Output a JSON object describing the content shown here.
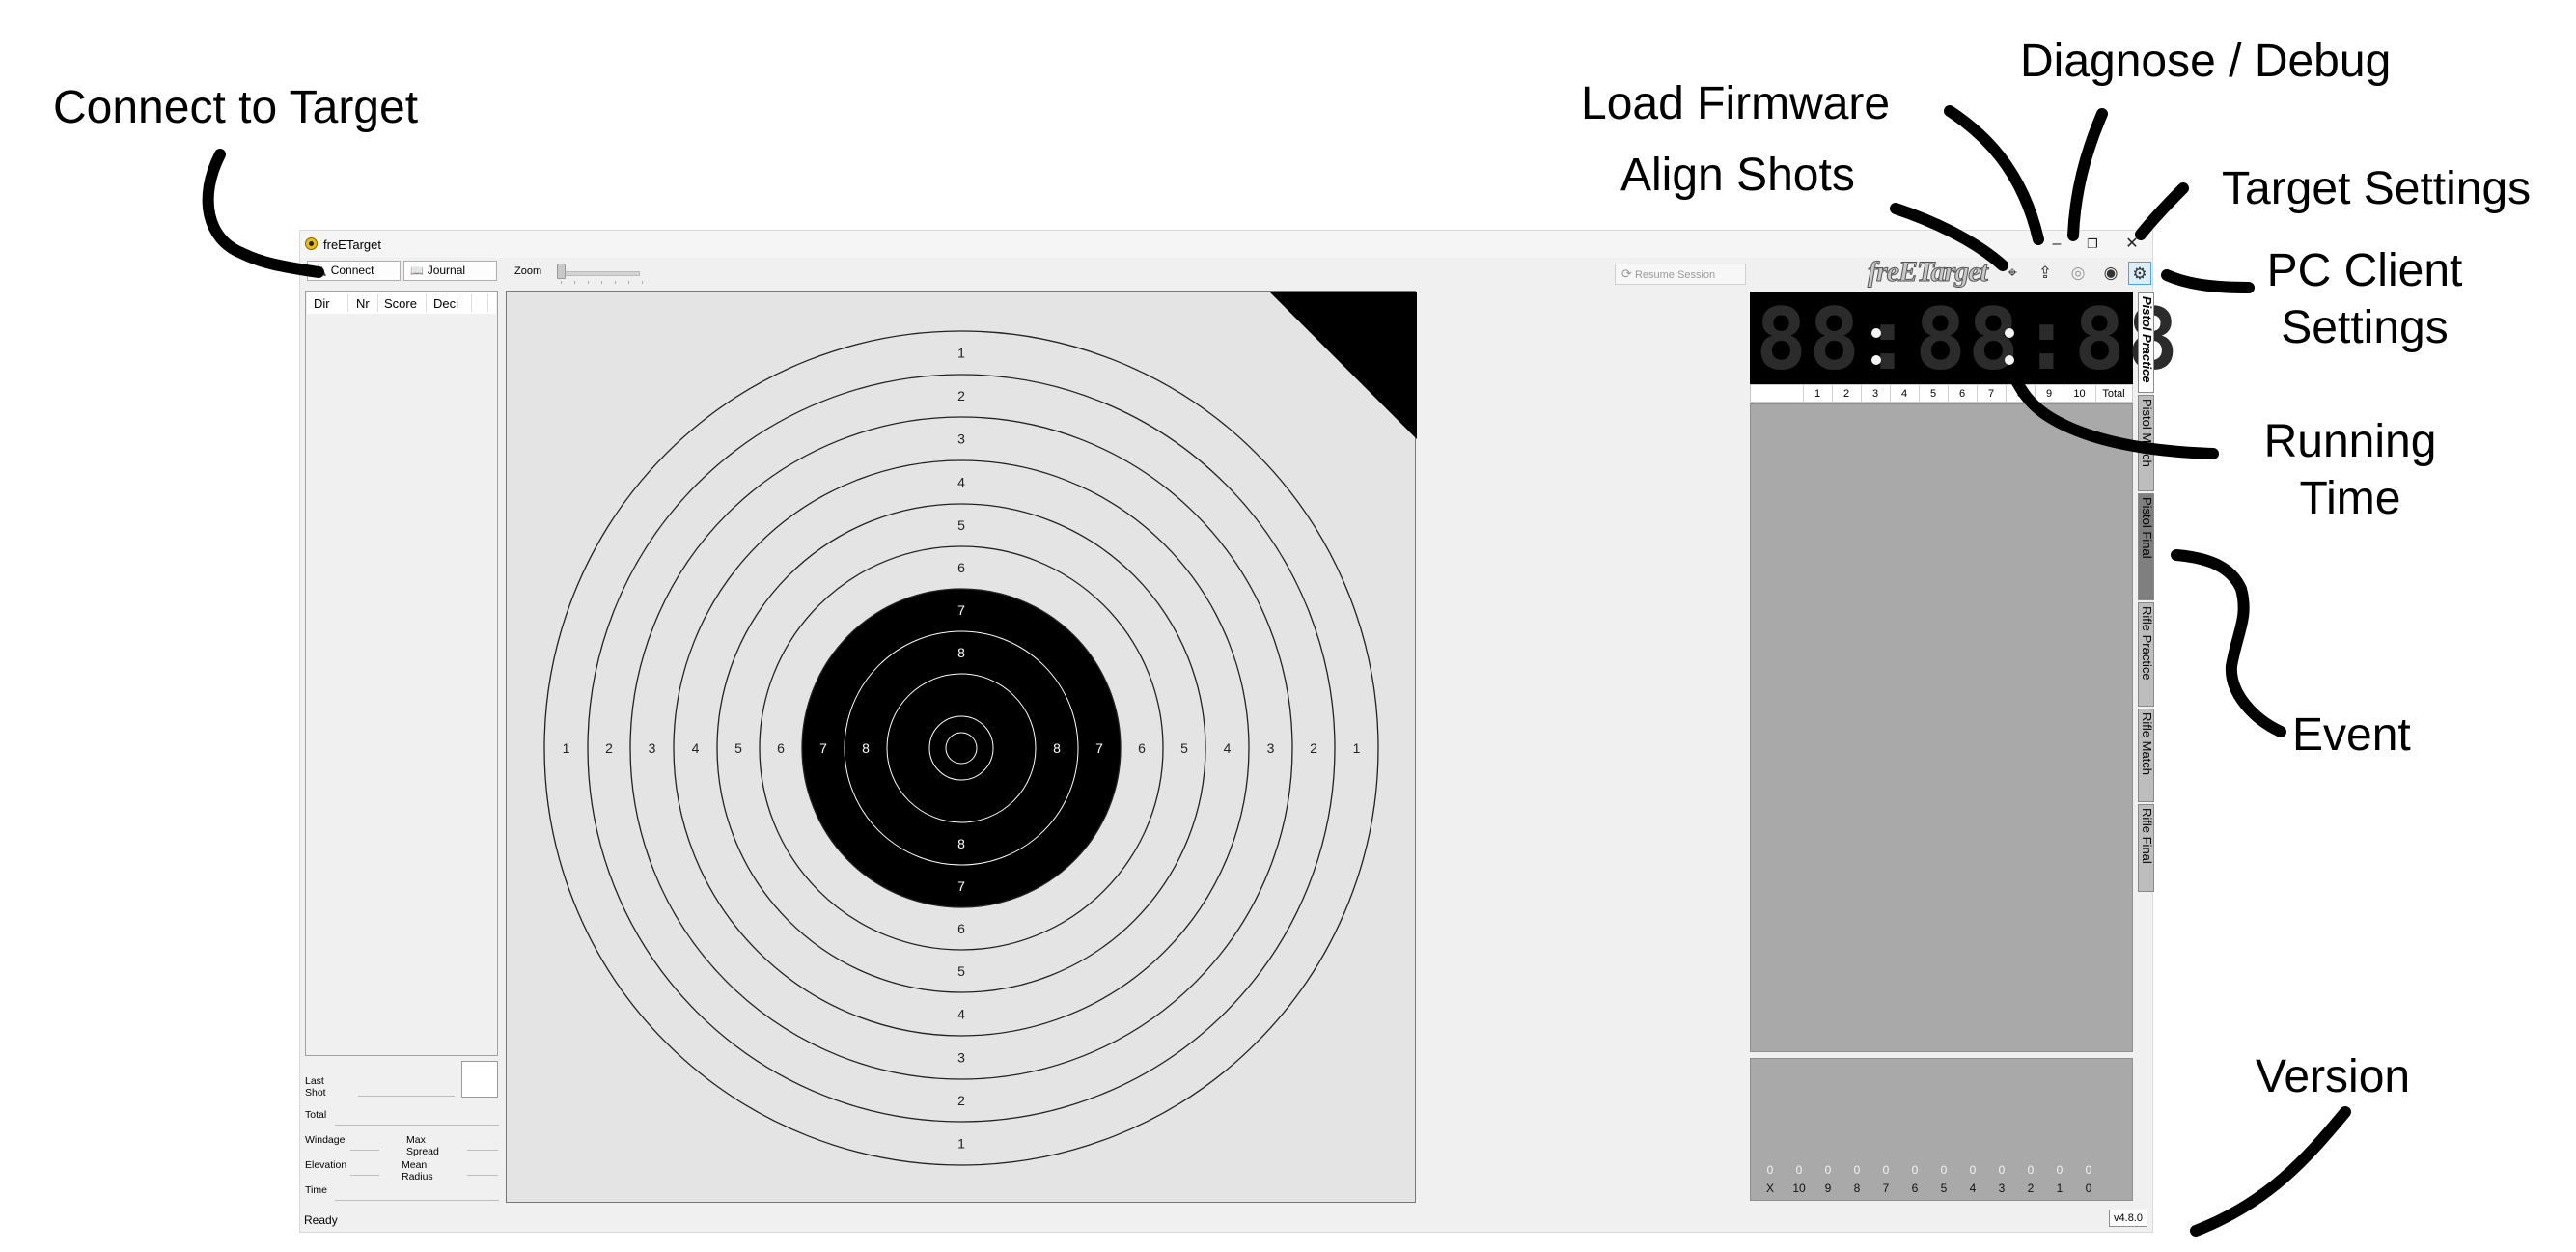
{
  "annotations": {
    "connect_to_target": "Connect to Target",
    "load_firmware": "Load Firmware",
    "diagnose_debug": "Diagnose / Debug",
    "align_shots": "Align Shots",
    "target_settings": "Target Settings",
    "pc_client_settings_1": "PC Client",
    "pc_client_settings_2": "Settings",
    "running_time_1": "Running",
    "running_time_2": "Time",
    "event": "Event",
    "version": "Version"
  },
  "window": {
    "title": "freETarget",
    "minimize": "–",
    "restore": "❐",
    "close": "✕"
  },
  "toolbar": {
    "connect_label": "Connect",
    "connect_icon": "plug-icon",
    "journal_label": "Journal",
    "journal_icon": "book-icon",
    "zoom_label": "Zoom",
    "zoom_value": 0,
    "resume_label": "Resume Session",
    "brand": "freETarget",
    "icons": [
      "align-shots-icon",
      "upload-firmware-icon",
      "fingerprint-debug-icon",
      "target-settings-icon",
      "gear-settings-icon"
    ]
  },
  "shot_table": {
    "columns": [
      "Dir",
      "Nr",
      "Score",
      "Deci"
    ],
    "rows": []
  },
  "stats": {
    "last_shot": "Last Shot",
    "total": "Total",
    "windage": "Windage",
    "max_spread": "Max Spread",
    "elevation": "Elevation",
    "mean_radius": "Mean Radius",
    "time": "Time"
  },
  "target": {
    "rings": [
      "1",
      "2",
      "3",
      "4",
      "5",
      "6",
      "7",
      "8"
    ]
  },
  "clock": {
    "digits": "88:88:88"
  },
  "score_table": {
    "columns": [
      "",
      "1",
      "2",
      "3",
      "4",
      "5",
      "6",
      "7",
      "8",
      "9",
      "10",
      "Total"
    ]
  },
  "histogram": {
    "labels": [
      "X",
      "10",
      "9",
      "8",
      "7",
      "6",
      "5",
      "4",
      "3",
      "2",
      "1",
      "0"
    ],
    "counts": [
      "0",
      "0",
      "0",
      "0",
      "0",
      "0",
      "0",
      "0",
      "0",
      "0",
      "0",
      "0"
    ]
  },
  "events": [
    "Pistol Practice",
    "Pistol Match",
    "Pistol Final",
    "Rifle Practice",
    "Rifle Match",
    "Rifle Final"
  ],
  "events_selected": "Pistol Practice",
  "status": {
    "text": "Ready",
    "version": "v4.8.0"
  }
}
